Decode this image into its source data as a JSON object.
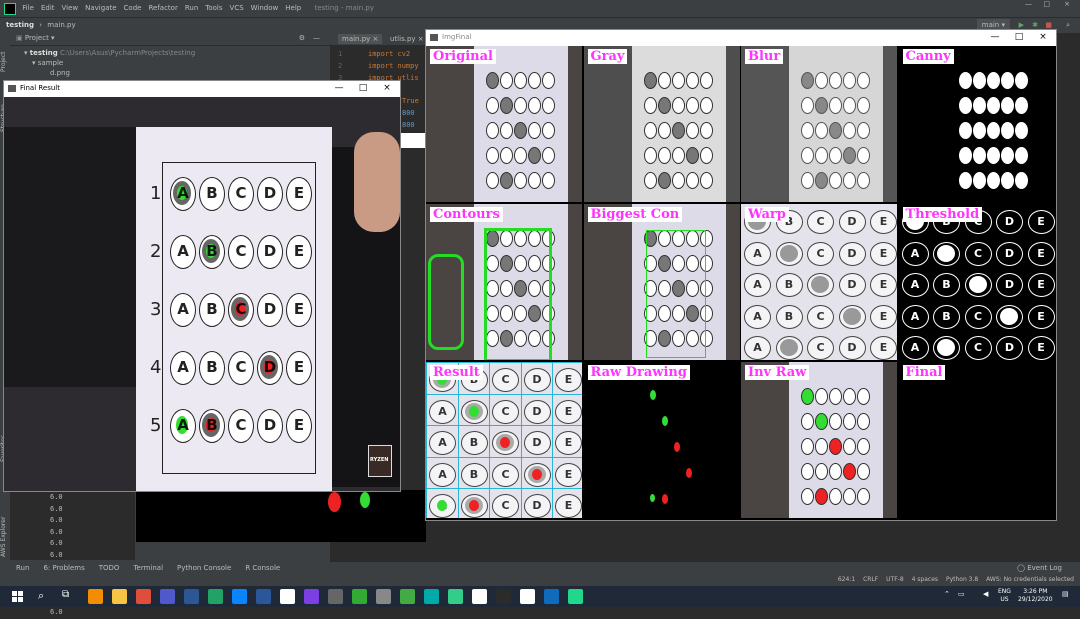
{
  "ide": {
    "menu": [
      "File",
      "Edit",
      "View",
      "Navigate",
      "Code",
      "Refactor",
      "Run",
      "Tools",
      "VCS",
      "Window",
      "Help"
    ],
    "window_title": "testing - main.py",
    "breadcrumb": [
      "testing",
      "main.py"
    ],
    "branch": "main",
    "project_label": "Project",
    "tree": [
      {
        "label": "testing",
        "path": "C:\\Users\\Asus\\PycharmProjects\\testing"
      },
      {
        "label": "sample"
      },
      {
        "label": "d.png"
      }
    ],
    "tabs": [
      "main.py",
      "utlis.py"
    ],
    "code_lines": [
      "import cv2",
      "import numpy",
      "import utlis"
    ],
    "line_numbers": [
      "1",
      "2",
      "3"
    ],
    "editor_values": [
      "True",
      "800",
      "800"
    ],
    "console_values": [
      "6.0",
      "6.0",
      "6.0",
      "6.0",
      "6.0",
      "6.0",
      "6.0",
      "6.0",
      "6.0",
      "6.0",
      "6.0"
    ],
    "bottom_tabs": [
      "Run",
      "6: Problems",
      "TODO",
      "Terminal",
      "Python Console",
      "R Console"
    ],
    "event_log": "Event Log",
    "left_strip_labels": [
      "Project",
      "Structure",
      "Favorites",
      "AWS Explorer"
    ],
    "status": {
      "position": "624:1",
      "crlf": "CRLF",
      "encoding": "UTF-8",
      "indent": "4 spaces",
      "interpreter": "Python 3.8",
      "aws": "AWS: No credentials selected"
    }
  },
  "final_result": {
    "title": "Final Result",
    "question_numbers": [
      "1",
      "2",
      "3",
      "4",
      "5"
    ],
    "letters": [
      "A",
      "B",
      "C",
      "D",
      "E"
    ],
    "answers": [
      0,
      1,
      2,
      3,
      0
    ],
    "marked": [
      0,
      1,
      2,
      3,
      1
    ],
    "correct": [
      true,
      true,
      false,
      false,
      false
    ],
    "card_text": "RYZEN"
  },
  "imgfinal": {
    "title": "ImgFinal",
    "cells": [
      {
        "key": "original",
        "label": "Original"
      },
      {
        "key": "gray",
        "label": "Gray"
      },
      {
        "key": "blur",
        "label": "Blur"
      },
      {
        "key": "canny",
        "label": "Canny"
      },
      {
        "key": "contours",
        "label": "Contours"
      },
      {
        "key": "biggest",
        "label": "Biggest Con"
      },
      {
        "key": "warp",
        "label": "Warp"
      },
      {
        "key": "threshold",
        "label": "Threshold"
      },
      {
        "key": "result",
        "label": "Result"
      },
      {
        "key": "raw",
        "label": "Raw Drawing"
      },
      {
        "key": "invraw",
        "label": "Inv Raw"
      },
      {
        "key": "final",
        "label": "Final"
      }
    ]
  },
  "taskbar": {
    "lang": "ENG",
    "region": "US",
    "time": "3:26 PM",
    "date": "29/12/2020"
  },
  "colors": {
    "correct": "#33dd33",
    "wrong": "#ee2222",
    "label": "#ff33ff",
    "grid": "#29b6d6"
  }
}
